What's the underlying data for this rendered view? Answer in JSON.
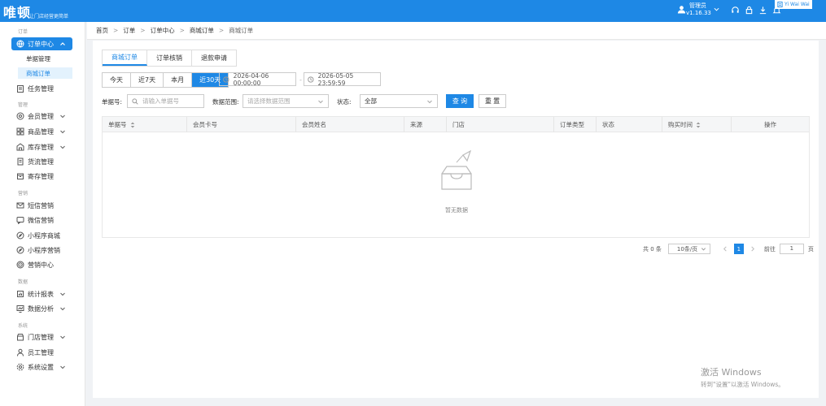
{
  "header": {
    "logo": "唯顿",
    "logo_sub": "让门店经营更简单",
    "username": "管理员",
    "version": "v1.16.33",
    "badge": "Yi Wai Wai"
  },
  "sidebar": {
    "sections": {
      "order": "订单",
      "manage": "管理",
      "marketing": "营销",
      "data": "数据",
      "system": "系统"
    },
    "items": {
      "order_center": "订单中心",
      "bill_manage": "单据管理",
      "mall_order": "商城订单",
      "task_manage": "任务管理",
      "member_manage": "会员管理",
      "goods_manage": "商品管理",
      "stock_manage": "库存管理",
      "logistics": "货流管理",
      "deposit": "寄存管理",
      "sms": "短信营销",
      "wechat": "微信营销",
      "mini_mall": "小程序商城",
      "mini_marketing": "小程序营销",
      "marketing_center": "营销中心",
      "stats_report": "统计报表",
      "data_analysis": "数据分析",
      "store_manage": "门店管理",
      "staff_manage": "员工管理",
      "system_settings": "系统设置"
    }
  },
  "breadcrumb": [
    "首页",
    "订单",
    "订单中心",
    "商城订单",
    "商城订单"
  ],
  "tabs": [
    "商城订单",
    "订单核销",
    "退款申请"
  ],
  "date_buttons": [
    "今天",
    "近7天",
    "本月",
    "近30天"
  ],
  "date_start": "2026-04-06 00:00:00",
  "date_end": "2026-05-05 23:59:59",
  "date_sep": "-",
  "filters": {
    "bill_label": "单据号:",
    "bill_placeholder": "请输入单据号",
    "range_label": "数据范围:",
    "range_placeholder": "请选择数据范围",
    "status_label": "状态:",
    "status_value": "全部",
    "query": "查 询",
    "reset": "重 置"
  },
  "table": {
    "columns": [
      "单据号",
      "会员卡号",
      "会员姓名",
      "来源",
      "门店",
      "订单类型",
      "状态",
      "购买时间",
      "操作"
    ],
    "empty": "暂无数据"
  },
  "pager": {
    "total": "共 0 条",
    "size": "10条/页",
    "current": "1",
    "goto": "前往",
    "goto_value": "1",
    "unit": "页"
  },
  "watermark": {
    "line1": "激活 Windows",
    "line2": "转到\"设置\"以激活 Windows。"
  },
  "colors": {
    "primary": "#1e88e5",
    "active_sub_bg": "#e3f2fd"
  }
}
